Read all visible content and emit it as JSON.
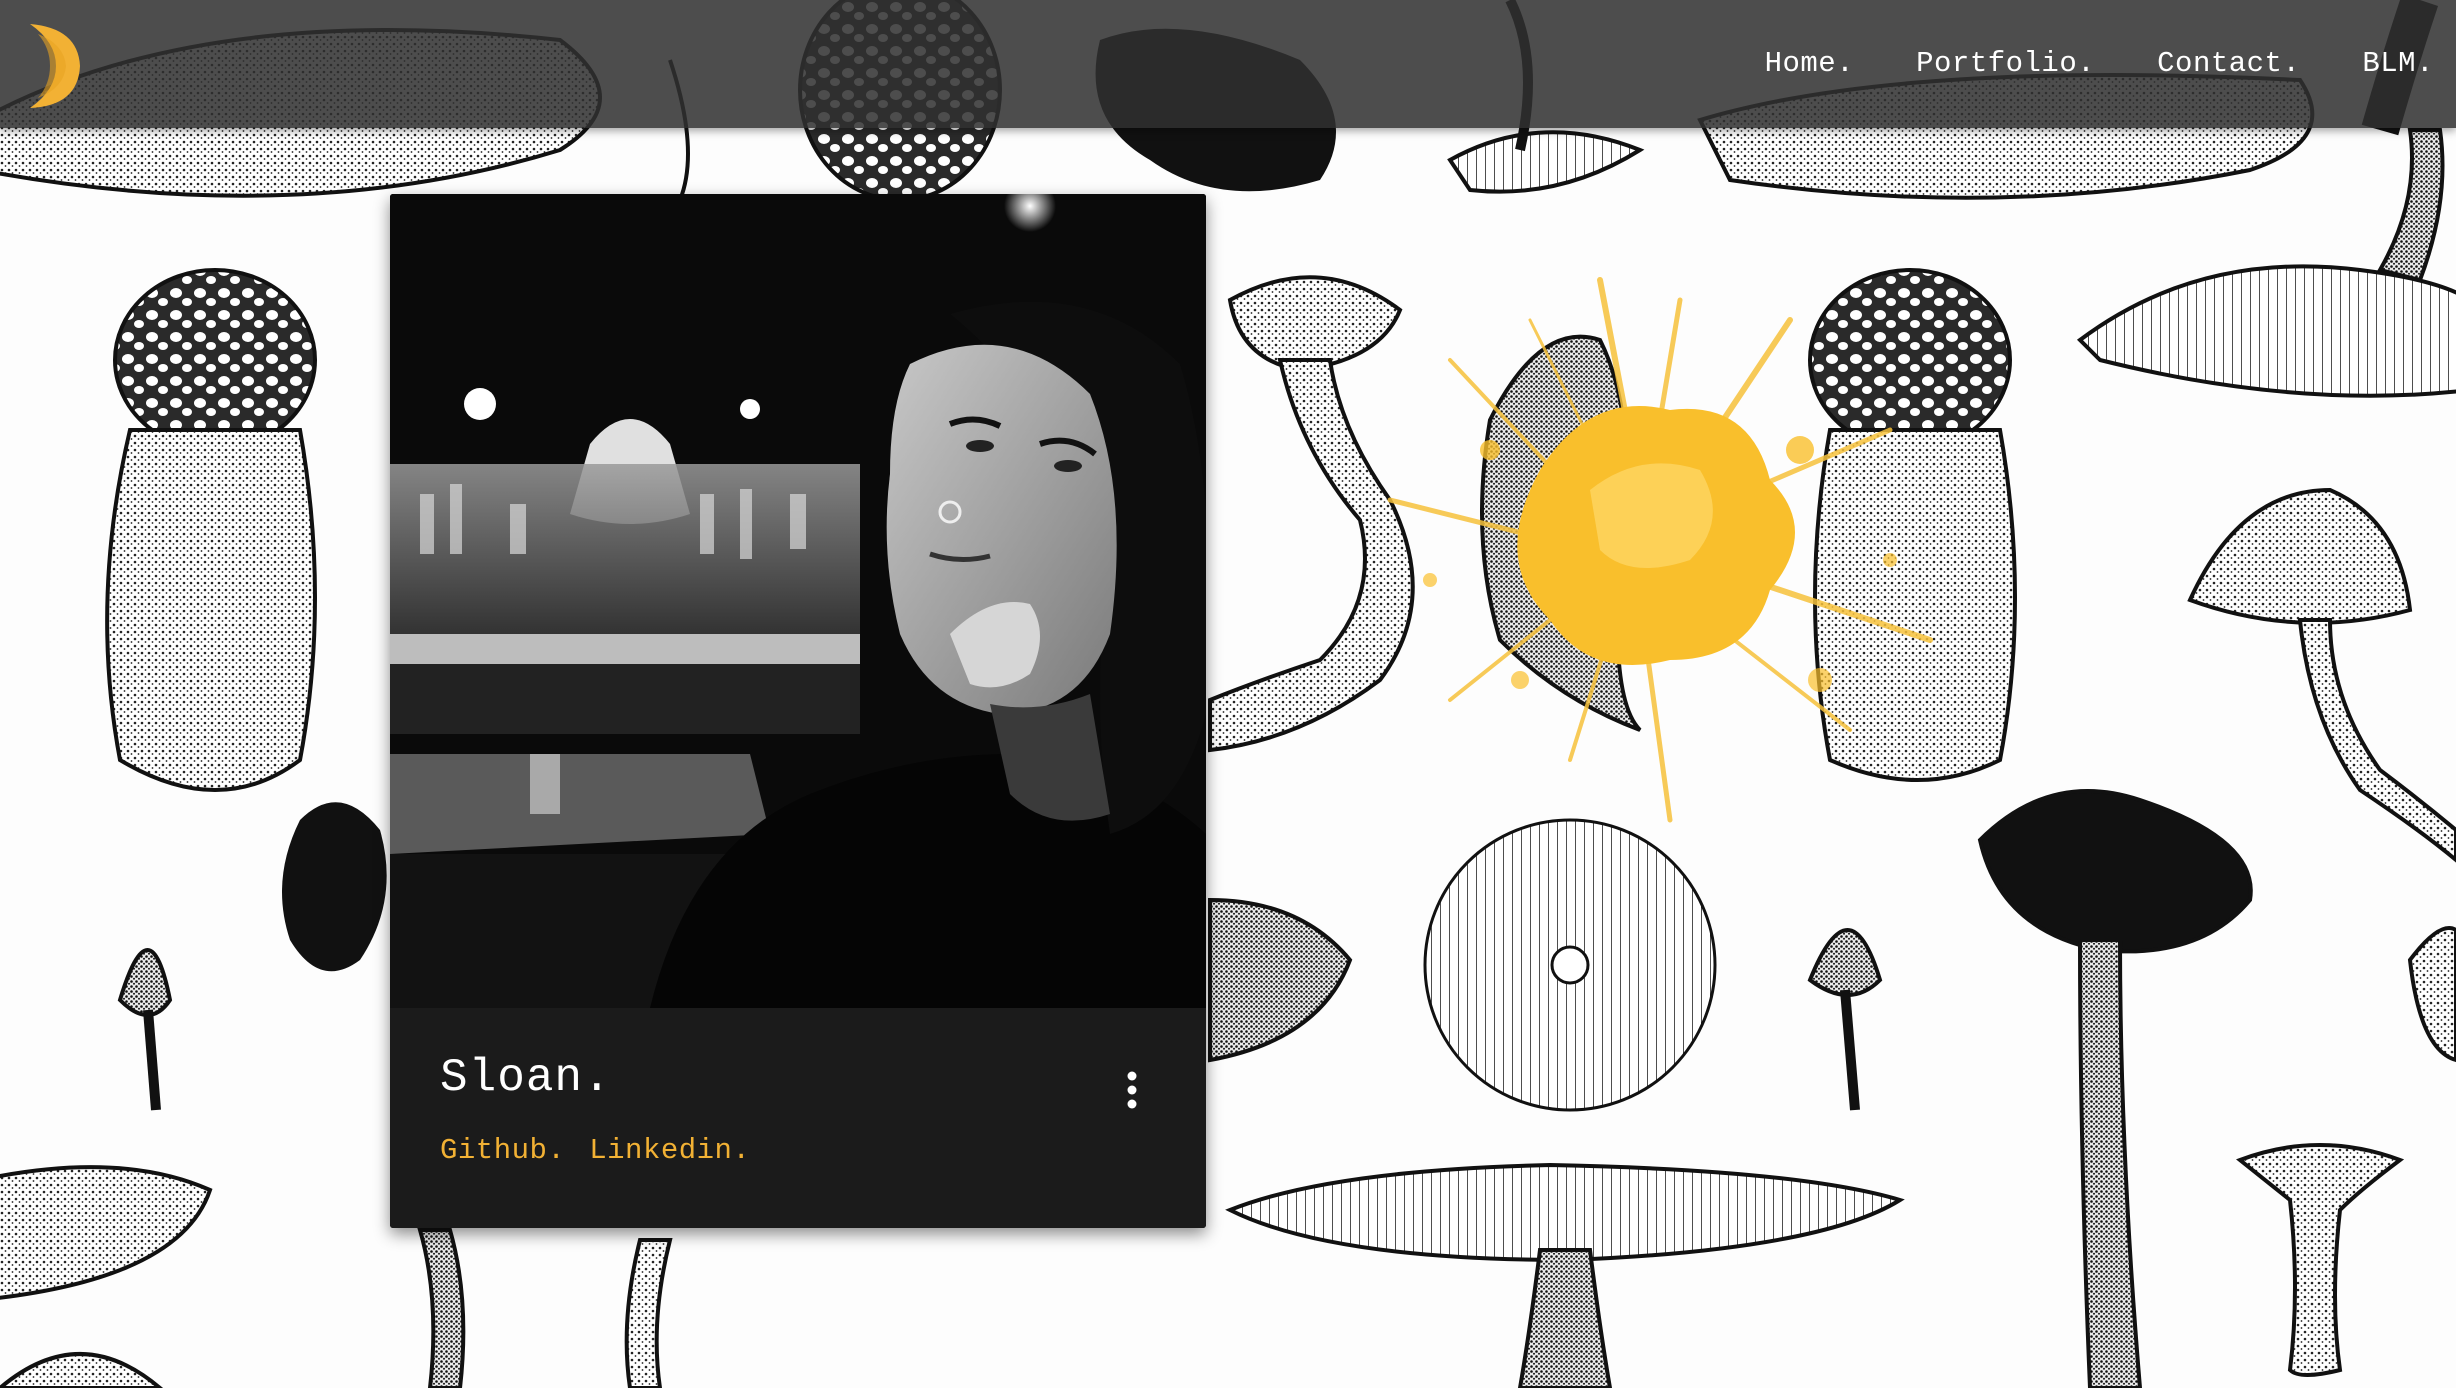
{
  "nav": {
    "logo_icon": "crescent-moon-icon",
    "links": [
      {
        "label": "Home."
      },
      {
        "label": "Portfolio."
      },
      {
        "label": "Contact."
      },
      {
        "label": "BLM."
      }
    ]
  },
  "card": {
    "title": "Sloan.",
    "photo_description_icon": "profile-photo",
    "menu_icon": "more-vert-icon",
    "links": [
      {
        "label": "Github."
      },
      {
        "label": "Linkedin."
      }
    ]
  },
  "background": {
    "pattern_icon": "mushroom-illustration-pattern",
    "splash_icon": "yellow-paint-splash"
  },
  "colors": {
    "accent": "#f2b134",
    "navbar": "#303030",
    "card": "#1b1b1b"
  }
}
